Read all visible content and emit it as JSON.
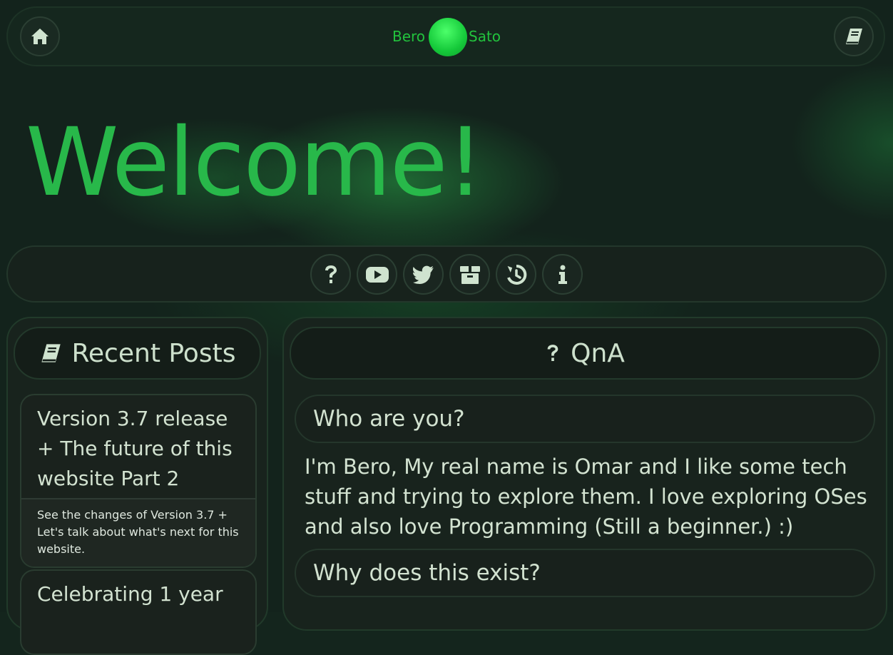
{
  "header": {
    "home_icon": "home-icon",
    "book_icon": "book-icon",
    "logo": {
      "left": "Bero",
      "right": "Sato"
    }
  },
  "hero": {
    "title": "Welcome!"
  },
  "iconbar": {
    "icons": [
      "question-icon",
      "youtube-icon",
      "twitter-icon",
      "box-icon",
      "history-icon",
      "info-icon"
    ]
  },
  "recent_posts": {
    "heading": "Recent Posts",
    "icon": "book-icon",
    "posts": [
      {
        "title": "Version 3.7 release + The future of this website Part 2",
        "description": "See the changes of Version 3.7 + Let's talk about what's next for this website."
      },
      {
        "title": "Celebrating 1 year",
        "description": ""
      }
    ]
  },
  "qna": {
    "heading": "QnA",
    "icon": "question-icon",
    "items": [
      {
        "question": "Who are you?",
        "answer": "I'm Bero, My real name is Omar and I like some tech stuff and trying to explore them. I love exploring OSes and also love Programming (Still a beginner.) :)"
      },
      {
        "question": "Why does this exist?",
        "answer": ""
      }
    ]
  },
  "colors": {
    "accent": "#28b84a",
    "logo_green": "#22c33d",
    "background": "#13231c"
  }
}
